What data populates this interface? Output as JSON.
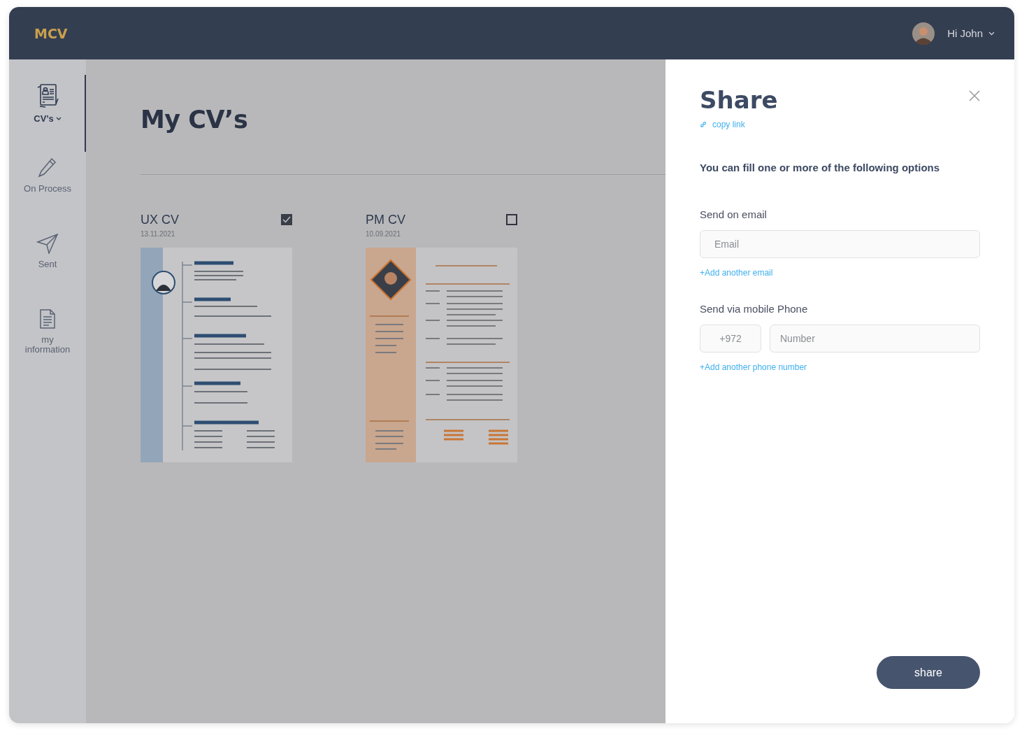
{
  "header": {
    "logo": "MCV",
    "greeting": "Hi John"
  },
  "sidebar": {
    "items": [
      {
        "kind": "cvs",
        "label": "CV’s",
        "selected": true,
        "has_menu": true
      },
      {
        "kind": "pencil",
        "label": "On Process",
        "selected": false,
        "has_menu": false
      },
      {
        "kind": "send",
        "label": "Sent",
        "selected": false,
        "has_menu": false
      },
      {
        "kind": "document",
        "label": "my information",
        "selected": false,
        "has_menu": false
      }
    ]
  },
  "main": {
    "title": "My CV’s",
    "cvs": [
      {
        "name": "UX CV",
        "date": "13.11.2021",
        "checked": true
      },
      {
        "name": "PM CV",
        "date": "10.09.2021",
        "checked": false
      }
    ]
  },
  "share_panel": {
    "title": "Share",
    "copy_link": "copy link",
    "instruction": "You can fill one or more of the following options",
    "email_section": {
      "label": "Send on email",
      "field": {
        "placeholder": "Email"
      },
      "add_link": "+Add another email"
    },
    "phone_section": {
      "label": "Send via mobile Phone",
      "prefix": {
        "placeholder": "+972"
      },
      "number": {
        "placeholder": "Number"
      },
      "add_link": "+Add another phone number"
    },
    "button": "share"
  }
}
